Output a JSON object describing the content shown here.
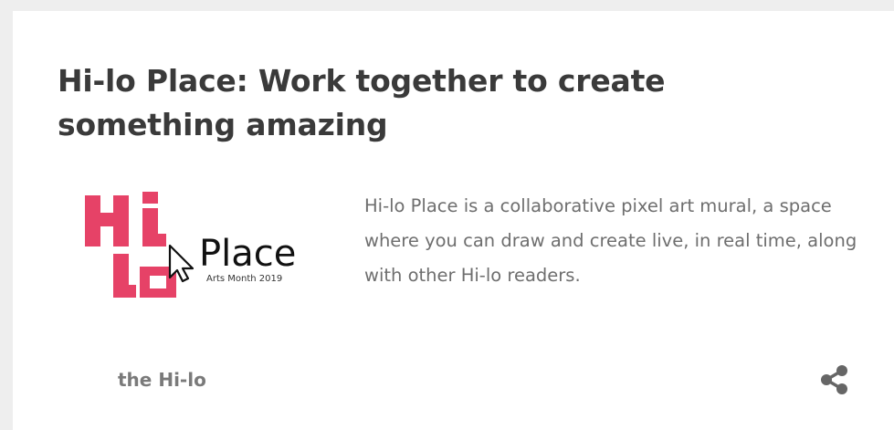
{
  "card": {
    "title": "Hi-lo Place: Work together to create something amazing",
    "description": "Hi-lo Place is a collaborative pixel art mural, a space where you can draw and create live, in real time, along with other Hi-lo readers.",
    "author": "the Hi-lo",
    "share_icon": "share-icon"
  },
  "logo": {
    "hi_text": "Hi",
    "lo_text": "lo",
    "place_text": "Place",
    "subtitle": "Arts Month 2019",
    "cursor_icon": "cursor-arrow-icon"
  },
  "colors": {
    "brand_pink": "#e64267",
    "title_text": "#3a3a3a",
    "body_text": "#6e6e6e",
    "author_text": "#7a7a7a",
    "share_icon": "#666666",
    "background": "#eeeeee",
    "card": "#ffffff"
  }
}
